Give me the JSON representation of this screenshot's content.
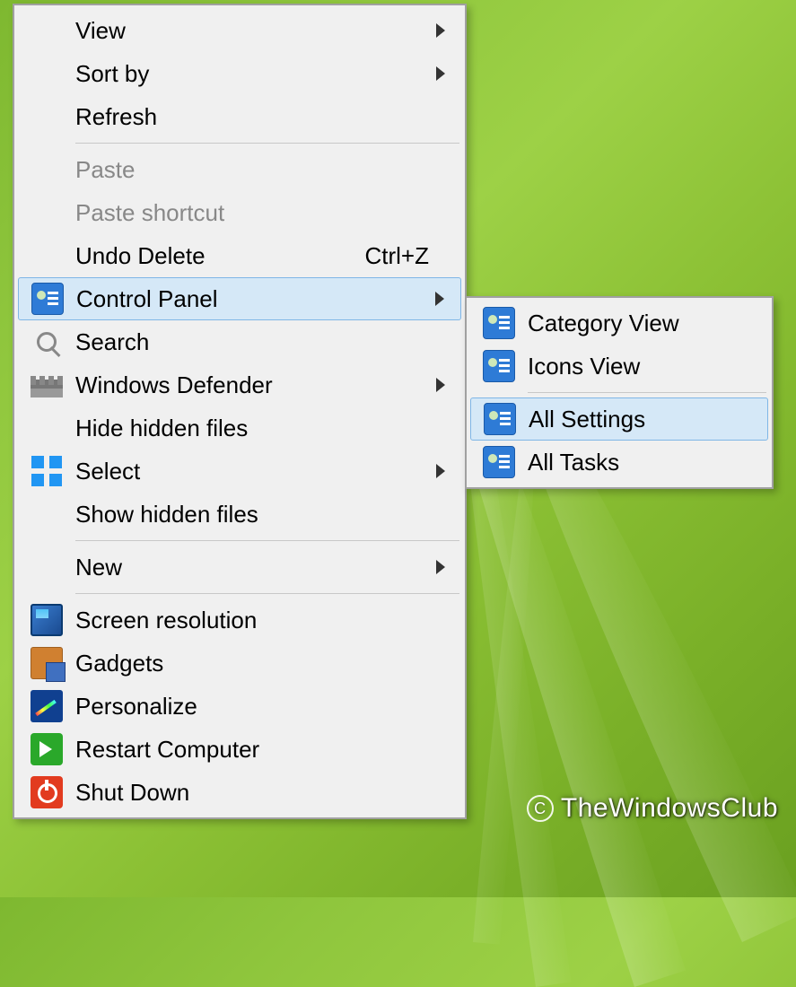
{
  "main_menu": {
    "items": [
      {
        "label": "View",
        "submenu": true
      },
      {
        "label": "Sort by",
        "submenu": true
      },
      {
        "label": "Refresh"
      },
      {
        "separator": true
      },
      {
        "label": "Paste",
        "disabled": true
      },
      {
        "label": "Paste shortcut",
        "disabled": true
      },
      {
        "label": "Undo Delete",
        "shortcut": "Ctrl+Z"
      },
      {
        "label": "Control Panel",
        "icon": "cpanel",
        "submenu": true,
        "highlight": true
      },
      {
        "label": "Search",
        "icon": "search"
      },
      {
        "label": "Windows Defender",
        "icon": "defender",
        "submenu": true
      },
      {
        "label": "Hide hidden files"
      },
      {
        "label": "Select",
        "icon": "select",
        "submenu": true
      },
      {
        "label": "Show hidden files"
      },
      {
        "separator": true
      },
      {
        "label": "New",
        "submenu": true
      },
      {
        "separator": true
      },
      {
        "label": "Screen resolution",
        "icon": "screen"
      },
      {
        "label": "Gadgets",
        "icon": "gadgets"
      },
      {
        "label": "Personalize",
        "icon": "personalize"
      },
      {
        "label": "Restart Computer",
        "icon": "restart"
      },
      {
        "label": "Shut Down",
        "icon": "shutdown"
      }
    ]
  },
  "sub_menu": {
    "items": [
      {
        "label": "Category View",
        "icon": "cpanel"
      },
      {
        "label": "Icons View",
        "icon": "cpanel"
      },
      {
        "separator": true
      },
      {
        "label": "All Settings",
        "icon": "cpanel",
        "highlight": true
      },
      {
        "label": "All Tasks",
        "icon": "cpanel"
      }
    ]
  },
  "watermark": {
    "symbol": "C",
    "text": "TheWindowsClub"
  }
}
